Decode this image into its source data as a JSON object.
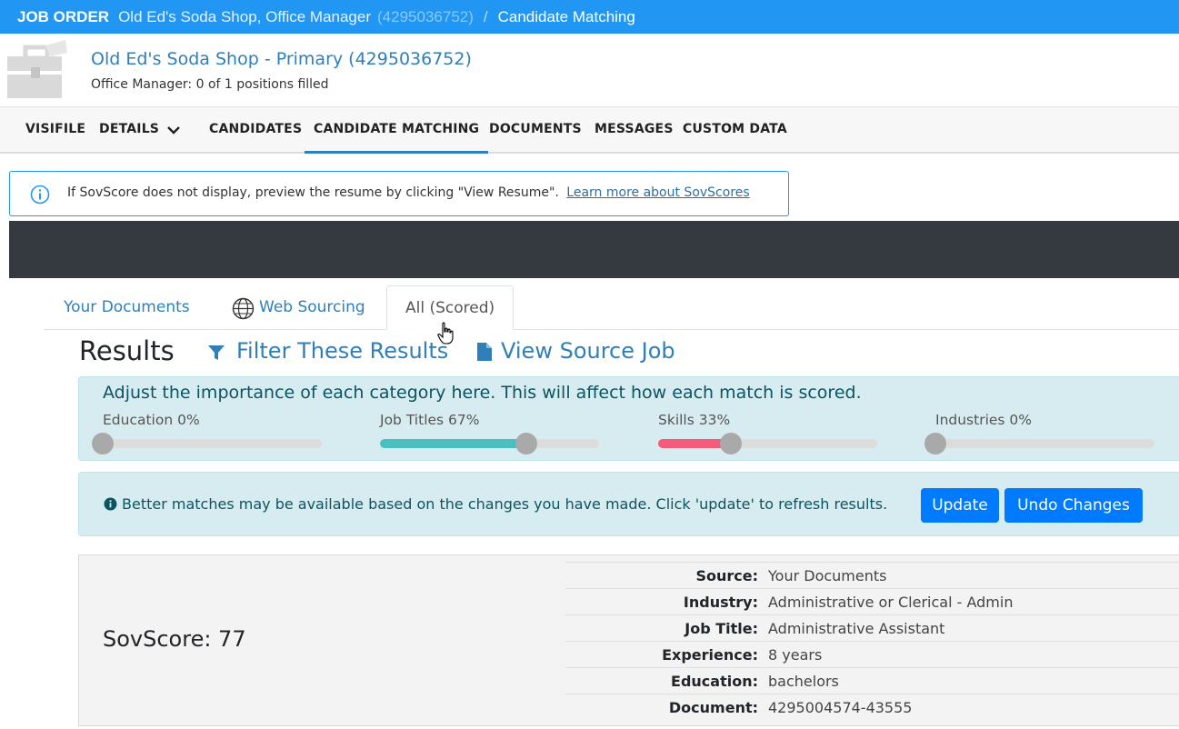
{
  "topbar": {
    "label": "JOB ORDER",
    "company_position": "Old Ed's Soda Shop, Office Manager",
    "id": "(4295036752)",
    "separator": "/",
    "page": "Candidate Matching"
  },
  "header": {
    "title": "Old Ed's Soda Shop - Primary (4295036752)",
    "subtitle": "Office Manager: 0 of 1 positions filled",
    "icon": "briefcase-icon"
  },
  "nav": {
    "items": [
      {
        "label": "VISIFILE"
      },
      {
        "label": "DETAILS"
      },
      {
        "label": "CANDIDATES"
      },
      {
        "label": "CANDIDATE MATCHING",
        "active": true
      },
      {
        "label": "DOCUMENTS"
      },
      {
        "label": "MESSAGES"
      },
      {
        "label": "CUSTOM DATA"
      }
    ]
  },
  "info": {
    "text": "If SovScore does not display, preview the resume by clicking \"View Resume\".",
    "link": "Learn more about SovScores"
  },
  "tabs": [
    {
      "label": "Your Documents"
    },
    {
      "label": "Web Sourcing"
    },
    {
      "label": "All (Scored)",
      "active": true
    }
  ],
  "results": {
    "title": "Results",
    "filter_label": "Filter These Results",
    "source_label": "View Source Job"
  },
  "weights": {
    "heading": "Adjust the importance of each category here. This will affect how each match is scored.",
    "sliders": [
      {
        "label": "Education 0%",
        "value": 0,
        "color": "#cccccc"
      },
      {
        "label": "Job Titles 67%",
        "value": 67,
        "color": "#4bbfbf"
      },
      {
        "label": "Skills 33%",
        "value": 33,
        "color": "#f25c7a"
      },
      {
        "label": "Industries 0%",
        "value": 0,
        "color": "#cccccc"
      }
    ]
  },
  "notice": {
    "text": "Better matches may be available based on the changes you have made. Click 'update' to refresh results.",
    "update_label": "Update",
    "undo_label": "Undo Changes"
  },
  "result_card": {
    "score": "SovScore: 77",
    "rows": [
      {
        "key": "Source:",
        "value": "Your Documents"
      },
      {
        "key": "Industry:",
        "value": "Administrative or Clerical - Admin"
      },
      {
        "key": "Job Title:",
        "value": "Administrative Assistant"
      },
      {
        "key": "Experience:",
        "value": "8 years"
      },
      {
        "key": "Education:",
        "value": "bachelors"
      },
      {
        "key": "Document:",
        "value": "4295004574-43555"
      }
    ]
  }
}
